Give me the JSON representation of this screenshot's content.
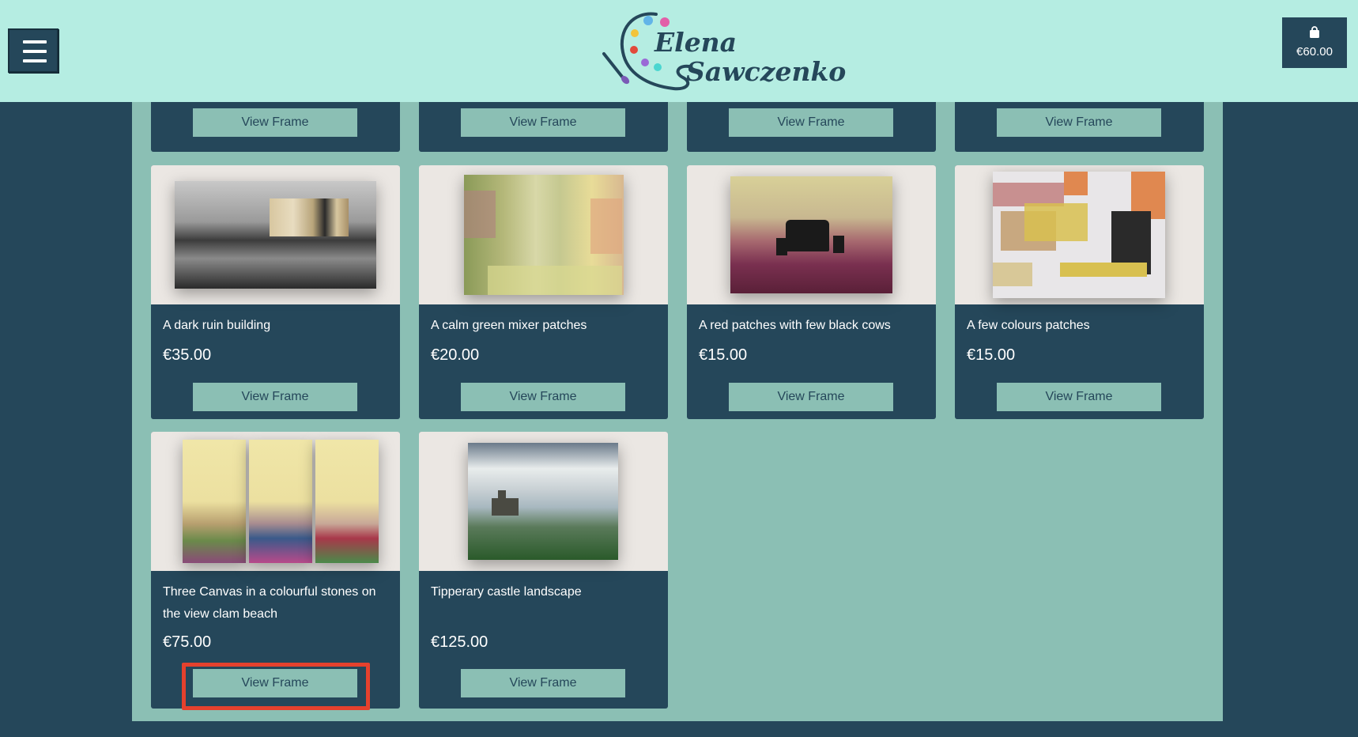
{
  "header": {
    "logo_first": "Elena",
    "logo_last": "Sawczenko",
    "cart_total": "€60.00"
  },
  "products": {
    "row1": [
      {
        "button": "View Frame"
      },
      {
        "button": "View Frame"
      },
      {
        "button": "View Frame"
      },
      {
        "button": "View Frame"
      }
    ],
    "row2": [
      {
        "title": "A dark ruin building",
        "price": "€35.00",
        "button": "View Frame"
      },
      {
        "title": "A calm green mixer patches",
        "price": "€20.00",
        "button": "View Frame"
      },
      {
        "title": "A red patches with few black cows",
        "price": "€15.00",
        "button": "View Frame"
      },
      {
        "title": "A few colours patches",
        "price": "€15.00",
        "button": "View Frame"
      }
    ],
    "row3": [
      {
        "title": "Three Canvas in a colourful stones on the view clam beach",
        "price": "€75.00",
        "button": "View Frame"
      },
      {
        "title": "Tipperary castle landscape",
        "price": "€125.00",
        "button": "View Frame"
      }
    ]
  },
  "colors": {
    "header_bg": "#b5ede2",
    "page_bg": "#25475a",
    "content_bg": "#8bbfb4",
    "card_bg": "#25475a",
    "button_bg": "#8bbfb4",
    "highlight": "#e5412d"
  },
  "icons": [
    "hamburger-menu-icon",
    "palette-icon",
    "shopping-bag-icon"
  ]
}
